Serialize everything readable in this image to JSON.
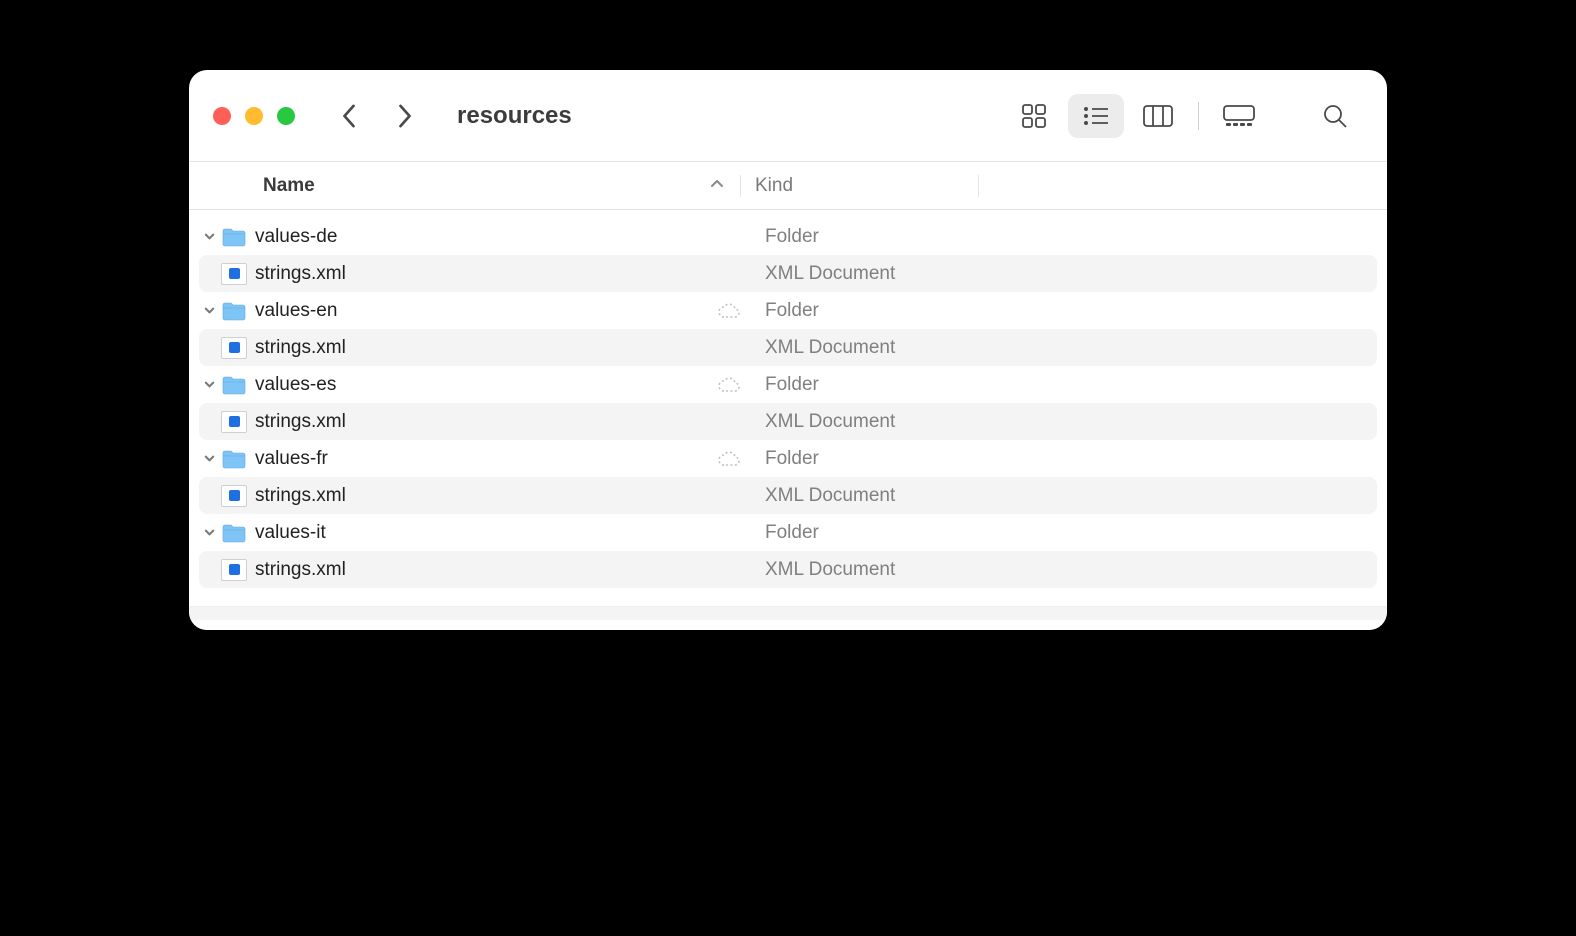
{
  "window": {
    "title": "resources"
  },
  "columns": {
    "name": "Name",
    "kind": "Kind"
  },
  "kinds": {
    "folder": "Folder",
    "xml": "XML Document"
  },
  "rows": [
    {
      "type": "folder",
      "name": "values-de",
      "kind": "Folder",
      "indent": 0,
      "cloud": false,
      "expanded": true
    },
    {
      "type": "file",
      "name": "strings.xml",
      "kind": "XML Document",
      "indent": 1
    },
    {
      "type": "folder",
      "name": "values-en",
      "kind": "Folder",
      "indent": 0,
      "cloud": true,
      "expanded": true
    },
    {
      "type": "file",
      "name": "strings.xml",
      "kind": "XML Document",
      "indent": 1
    },
    {
      "type": "folder",
      "name": "values-es",
      "kind": "Folder",
      "indent": 0,
      "cloud": true,
      "expanded": true
    },
    {
      "type": "file",
      "name": "strings.xml",
      "kind": "XML Document",
      "indent": 1
    },
    {
      "type": "folder",
      "name": "values-fr",
      "kind": "Folder",
      "indent": 0,
      "cloud": true,
      "expanded": true
    },
    {
      "type": "file",
      "name": "strings.xml",
      "kind": "XML Document",
      "indent": 1
    },
    {
      "type": "folder",
      "name": "values-it",
      "kind": "Folder",
      "indent": 0,
      "cloud": false,
      "expanded": true
    },
    {
      "type": "file",
      "name": "strings.xml",
      "kind": "XML Document",
      "indent": 1
    }
  ]
}
